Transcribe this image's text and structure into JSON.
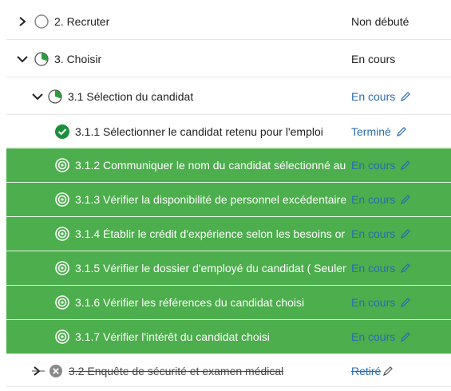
{
  "rows": [
    {
      "label": "2. Recruter",
      "status": "Non débuté"
    },
    {
      "label": "3. Choisir",
      "status": "En cours"
    },
    {
      "label": "3.1 Sélection du candidat",
      "status": "En cours"
    },
    {
      "label": "3.1.1 Sélectionner le candidat retenu pour l'emploi",
      "status": "Terminé"
    },
    {
      "label": "3.1.2 Communiquer le nom du candidat sélectionné au",
      "status": "En cours"
    },
    {
      "label": "3.1.3 Vérifier la disponibilité de personnel excédentaire",
      "status": "En cours"
    },
    {
      "label": "3.1.4 Établir le crédit d'expérience selon les besoins or",
      "status": "En cours"
    },
    {
      "label": "3.1.5 Vérifier le dossier d'employé du candidat ( Seulen",
      "status": "En cours"
    },
    {
      "label": "3.1.6 Vérifier les références du candidat choisi",
      "status": "En cours"
    },
    {
      "label": "3.1.7 Vérifier l'intérêt du candidat choisi",
      "status": "En cours"
    },
    {
      "label": "3.2 Enquête de sécurité et examen médical",
      "status": "Retiré"
    }
  ],
  "colors": {
    "highlight": "#4cae4c",
    "link": "#2b6cb0",
    "done": "#1e8e3e"
  }
}
